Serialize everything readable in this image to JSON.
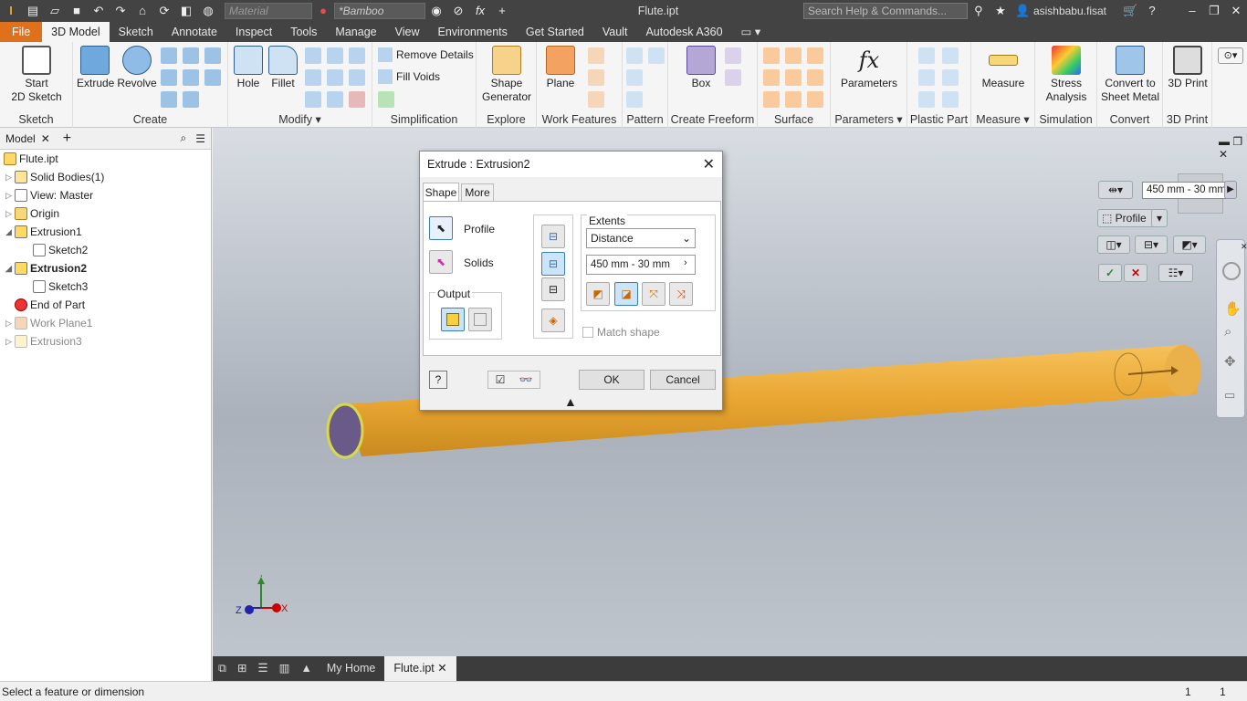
{
  "app": {
    "file_title": "Flute.ipt",
    "material_placeholder": "Material",
    "appearance": "*Bamboo",
    "search_placeholder": "Search Help & Commands...",
    "user": "asishbabu.fisat"
  },
  "ribbon_tabs": [
    "File",
    "3D Model",
    "Sketch",
    "Annotate",
    "Inspect",
    "Tools",
    "Manage",
    "View",
    "Environments",
    "Get Started",
    "Vault",
    "Autodesk A360"
  ],
  "ribbon": {
    "sketch": {
      "label": "Sketch",
      "start": "Start",
      "start2": "2D Sketch"
    },
    "create": {
      "label": "Create",
      "extrude": "Extrude",
      "revolve": "Revolve"
    },
    "modify": {
      "label": "Modify",
      "hole": "Hole",
      "fillet": "Fillet"
    },
    "simplification": {
      "label": "Simplification",
      "remove": "Remove Details",
      "fill": "Fill Voids"
    },
    "explore": {
      "label": "Explore",
      "shape1": "Shape",
      "shape2": "Generator"
    },
    "work": {
      "label": "Work Features",
      "plane": "Plane"
    },
    "pattern": {
      "label": "Pattern"
    },
    "freeform": {
      "label": "Create Freeform",
      "box": "Box"
    },
    "surface": {
      "label": "Surface"
    },
    "parameters": {
      "label": "Parameters",
      "btn": "Parameters"
    },
    "plastic": {
      "label": "Plastic Part"
    },
    "measure": {
      "label": "Measure",
      "btn": "Measure"
    },
    "simulation": {
      "label": "Simulation",
      "b1": "Stress",
      "b2": "Analysis"
    },
    "convert": {
      "label": "Convert",
      "b1": "Convert to",
      "b2": "Sheet Metal"
    },
    "print": {
      "label": "3D Print",
      "btn": "3D Print"
    }
  },
  "browser": {
    "tab": "Model",
    "items": [
      "Flute.ipt",
      "Solid Bodies(1)",
      "View: Master",
      "Origin",
      "Extrusion1",
      "Sketch2",
      "Extrusion2",
      "Sketch3",
      "End of Part",
      "Work Plane1",
      "Extrusion3"
    ]
  },
  "dialog": {
    "title": "Extrude : Extrusion2",
    "tab_shape": "Shape",
    "tab_more": "More",
    "profile": "Profile",
    "solids": "Solids",
    "output": "Output",
    "extents": "Extents",
    "distance": "Distance",
    "value": "450 mm - 30 mm",
    "match": "Match shape",
    "ok": "OK",
    "cancel": "Cancel"
  },
  "viewport": {
    "mini_value": "450 mm - 30 mm",
    "mini_profile": "Profile",
    "axis_x": "X",
    "axis_y": "Y",
    "axis_z": "Z"
  },
  "doctabs": {
    "home": "My Home",
    "file": "Flute.ipt"
  },
  "status": {
    "message": "Select a feature or dimension",
    "n1": "1",
    "n2": "1"
  }
}
